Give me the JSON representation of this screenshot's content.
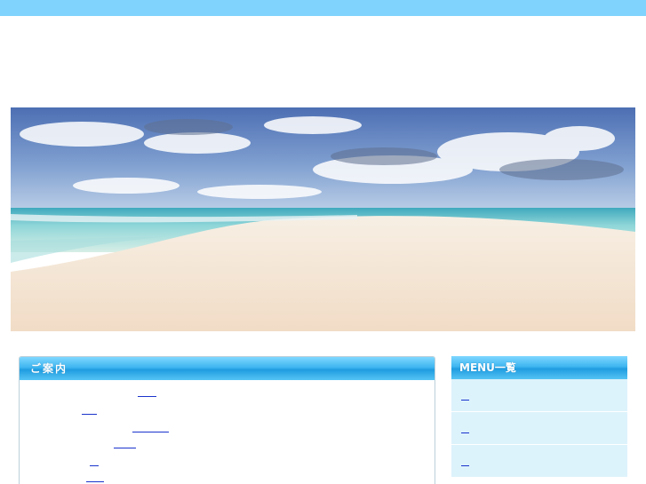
{
  "colors": {
    "topbar": "#7fd3fc",
    "header_gradient_top": "#7fd7ff",
    "header_gradient_bottom": "#1f9ce0",
    "menu_item_bg": "#ddf3fc",
    "link": "#1a33cc"
  },
  "hero": {
    "image": "beach-sandbar-photo"
  },
  "info": {
    "title": "ご案内",
    "links": [
      "",
      "",
      "",
      "",
      "",
      ""
    ]
  },
  "menu": {
    "title": "MENU一覧",
    "items": [
      "",
      "",
      ""
    ]
  }
}
